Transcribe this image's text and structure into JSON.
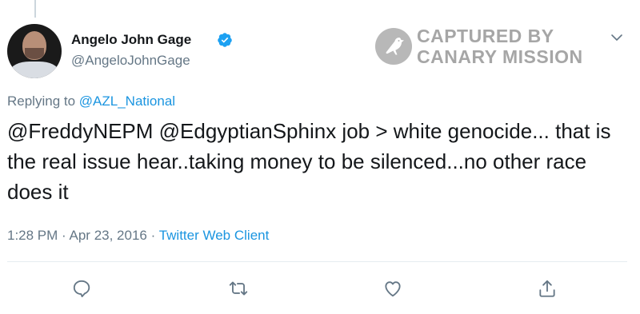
{
  "author": {
    "display_name": "Angelo John Gage",
    "handle": "@AngeloJohnGage",
    "verified": true
  },
  "watermark": {
    "line1": "CAPTURED BY",
    "line2": "CANARY MISSION",
    "color": "#a6a6a6"
  },
  "reply": {
    "prefix": "Replying to",
    "mention": "@AZL_National"
  },
  "tweet": {
    "text": "@FreddyNEPM @EdgyptianSphinx job > white genocide... that is the real issue hear..taking money to be silenced...no other race does it"
  },
  "meta": {
    "time": "1:28 PM",
    "separator": "·",
    "date": "Apr 23, 2016",
    "source": "Twitter Web Client"
  },
  "actions": {
    "icons": [
      "reply-icon",
      "retweet-icon",
      "like-icon",
      "share-icon"
    ]
  },
  "colors": {
    "accent": "#1b95e0",
    "secondary_text": "#657786",
    "primary_text": "#14171a",
    "verified": "#1da1f2"
  }
}
